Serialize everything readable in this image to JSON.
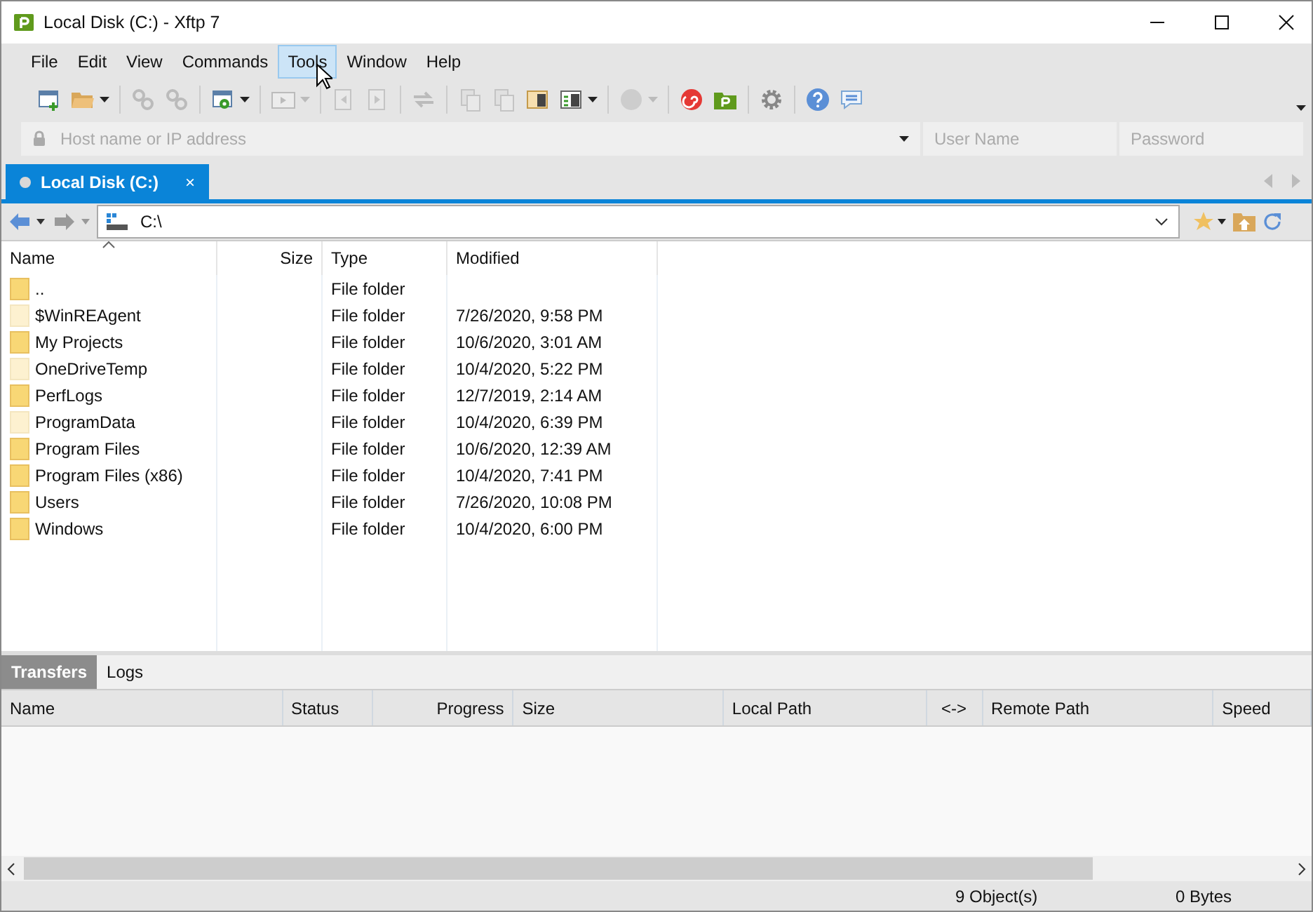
{
  "window": {
    "title": "Local Disk (C:) - Xftp 7"
  },
  "menu": [
    {
      "label": "File",
      "selected": false
    },
    {
      "label": "Edit",
      "selected": false
    },
    {
      "label": "View",
      "selected": false
    },
    {
      "label": "Commands",
      "selected": false
    },
    {
      "label": "Tools",
      "selected": true
    },
    {
      "label": "Window",
      "selected": false
    },
    {
      "label": "Help",
      "selected": false
    }
  ],
  "toolbar": [
    {
      "kind": "new",
      "disabled": false,
      "dropdown": false
    },
    {
      "kind": "open",
      "disabled": false,
      "dropdown": true
    },
    {
      "kind": "separator"
    },
    {
      "kind": "link",
      "disabled": true,
      "dropdown": false
    },
    {
      "kind": "unlink",
      "disabled": true,
      "dropdown": false
    },
    {
      "kind": "separator"
    },
    {
      "kind": "properties",
      "disabled": false,
      "dropdown": true
    },
    {
      "kind": "separator"
    },
    {
      "kind": "terminal",
      "disabled": true,
      "dropdown": true
    },
    {
      "kind": "separator"
    },
    {
      "kind": "upload",
      "disabled": true,
      "dropdown": false
    },
    {
      "kind": "download",
      "disabled": true,
      "dropdown": false
    },
    {
      "kind": "separator"
    },
    {
      "kind": "transfer",
      "disabled": true,
      "dropdown": false
    },
    {
      "kind": "separator"
    },
    {
      "kind": "copy",
      "disabled": true,
      "dropdown": false
    },
    {
      "kind": "paste",
      "disabled": true,
      "dropdown": false
    },
    {
      "kind": "panel",
      "disabled": false,
      "dropdown": false
    },
    {
      "kind": "layout",
      "disabled": false,
      "dropdown": true
    },
    {
      "kind": "separator"
    },
    {
      "kind": "circle",
      "disabled": true,
      "dropdown": true
    },
    {
      "kind": "separator"
    },
    {
      "kind": "swirl",
      "disabled": false,
      "dropdown": false
    },
    {
      "kind": "xftp",
      "disabled": false,
      "dropdown": false
    },
    {
      "kind": "separator"
    },
    {
      "kind": "gear",
      "disabled": false,
      "dropdown": false
    },
    {
      "kind": "separator"
    },
    {
      "kind": "help",
      "disabled": false,
      "dropdown": false
    },
    {
      "kind": "chat",
      "disabled": false,
      "dropdown": false
    }
  ],
  "connect": {
    "host": {
      "placeholder": "Host name or IP address"
    },
    "user": {
      "placeholder": "User Name"
    },
    "password": {
      "placeholder": "Password"
    }
  },
  "tabs": [
    {
      "label": "Local Disk (C:)",
      "selected": true,
      "close": "×"
    }
  ],
  "address": {
    "value": "C:\\"
  },
  "file_list": {
    "columns": [
      {
        "label": "Name",
        "sorted": true
      },
      {
        "label": "Size",
        "sorted": false
      },
      {
        "label": "Type",
        "sorted": false
      },
      {
        "label": "Modified",
        "sorted": false
      }
    ],
    "rows": [
      {
        "name": "..",
        "size": "",
        "type": "File folder",
        "modified": "",
        "hidden": false
      },
      {
        "name": "$WinREAgent",
        "type": "File folder",
        "modified": "7/26/2020, 9:58 PM",
        "hidden": true
      },
      {
        "name": "My Projects",
        "type": "File folder",
        "modified": "10/6/2020, 3:01 AM",
        "hidden": false
      },
      {
        "name": "OneDriveTemp",
        "type": "File folder",
        "modified": "10/4/2020, 5:22 PM",
        "hidden": true
      },
      {
        "name": "PerfLogs",
        "type": "File folder",
        "modified": "12/7/2019, 2:14 AM",
        "hidden": false
      },
      {
        "name": "ProgramData",
        "type": "File folder",
        "modified": "10/4/2020, 6:39 PM",
        "hidden": true
      },
      {
        "name": "Program Files",
        "type": "File folder",
        "modified": "10/6/2020, 12:39 AM",
        "hidden": false
      },
      {
        "name": "Program Files (x86)",
        "type": "File folder",
        "modified": "10/4/2020, 7:41 PM",
        "hidden": false
      },
      {
        "name": "Users",
        "type": "File folder",
        "modified": "7/26/2020, 10:08 PM",
        "hidden": false
      },
      {
        "name": "Windows",
        "type": "File folder",
        "modified": "10/4/2020, 6:00 PM",
        "hidden": false
      }
    ]
  },
  "bottom_tabs": [
    {
      "label": "Transfers",
      "selected": true
    },
    {
      "label": "Logs",
      "selected": false
    }
  ],
  "transfers": {
    "columns": [
      {
        "label": "Name"
      },
      {
        "label": "Status"
      },
      {
        "label": "Progress"
      },
      {
        "label": "Size"
      },
      {
        "label": "Local Path"
      },
      {
        "label": "<->"
      },
      {
        "label": "Remote Path"
      },
      {
        "label": "Speed"
      }
    ]
  },
  "status_bar": {
    "objects": "9 Object(s)",
    "bytes": "0 Bytes"
  }
}
